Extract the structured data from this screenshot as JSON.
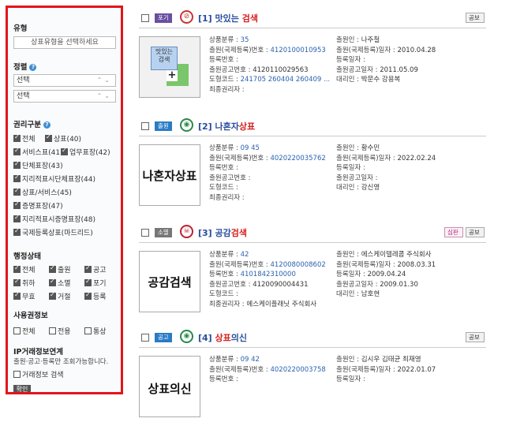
{
  "sidebar": {
    "type_section": {
      "title": "유형",
      "select_placeholder": "상표유형을 선택하세요"
    },
    "sort_section": {
      "title": "정렬",
      "select1": "선택",
      "select2": "선택"
    },
    "rights_section": {
      "title": "권리구분",
      "items": [
        {
          "label": "전체",
          "checked": true
        },
        {
          "label": "상표(40)",
          "checked": true
        },
        {
          "label": "서비스표(41)",
          "checked": true
        },
        {
          "label": "업무표장(42)",
          "checked": true
        },
        {
          "label": "단체표장(43)",
          "checked": true
        },
        {
          "label": "지리적표시단체표장(44)",
          "checked": true
        },
        {
          "label": "상표/서비스(45)",
          "checked": true
        },
        {
          "label": "증명표장(47)",
          "checked": true
        },
        {
          "label": "지리적표시증명표장(48)",
          "checked": true
        },
        {
          "label": "국제등록상표(마드리드)",
          "checked": true
        }
      ]
    },
    "status_section": {
      "title": "행정상태",
      "items": [
        {
          "label": "전체",
          "checked": true
        },
        {
          "label": "출원",
          "checked": true
        },
        {
          "label": "공고",
          "checked": true
        },
        {
          "label": "취하",
          "checked": true
        },
        {
          "label": "소멸",
          "checked": true
        },
        {
          "label": "포기",
          "checked": true
        },
        {
          "label": "무효",
          "checked": true
        },
        {
          "label": "거절",
          "checked": true
        },
        {
          "label": "등록",
          "checked": true
        }
      ]
    },
    "usage_section": {
      "title": "사용권정보",
      "items": [
        {
          "label": "전체",
          "checked": false
        },
        {
          "label": "전용",
          "checked": false
        },
        {
          "label": "통상",
          "checked": false
        }
      ]
    },
    "ip_section": {
      "title": "IP거래정보연계",
      "note": "출원·공고·등록만 조회가능합니다.",
      "checkbox_label": "거래정보 검색",
      "checked": false,
      "button_label": "확인"
    }
  },
  "results": [
    {
      "status": "포기",
      "status_color": "#6a4fa0",
      "icon": "circle-slash-icon",
      "icon_glyph": "⊘",
      "icon_color": "#c33",
      "num": "[1]",
      "title_plain": "맛있는 ",
      "title_hl": "검색",
      "tags": [
        "공보"
      ],
      "thumb_text_1": "맛있는",
      "thumb_text_2": "검색",
      "fields": {
        "prod_label": "상품분류 :",
        "prod_value": "35",
        "appno_label": "출원(국제등록)번호 :",
        "appno_value": "4120100010953",
        "regno_label": "등록번호 :",
        "regno_value": "",
        "pubno_label": "출원공고번호 :",
        "pubno_value": "4120110029563",
        "figure_label": "도형코드 :",
        "figure_value": "241705 260404 260409 ...",
        "owner_label": "최종권리자 :",
        "owner_value": "",
        "applicant_label": "출원인 :",
        "applicant_value": "나주철",
        "appdate_label": "출원(국제등록)일자 :",
        "appdate_value": "2010.04.28",
        "regdate_label": "등록일자 :",
        "regdate_value": "",
        "pubdate_label": "출원공고일자 :",
        "pubdate_value": "2011.05.09",
        "agent_label": "대리인 :",
        "agent_value": "박문수 강용복"
      }
    },
    {
      "status": "출원",
      "status_color": "#2a7bc5",
      "icon": "eye-icon",
      "icon_glyph": "◉",
      "icon_color": "#2a8a4a",
      "num": "[2]",
      "title_plain": "나혼자",
      "title_hl": "상표",
      "tags": [],
      "thumb_text": "나혼자상표",
      "fields": {
        "prod_label": "상품분류 :",
        "prod_value": "09 45",
        "appno_label": "출원(국제등록)번호 :",
        "appno_value": "4020220035762",
        "regno_label": "등록번호 :",
        "regno_value": "",
        "pubno_label": "출원공고번호 :",
        "pubno_value": "",
        "figure_label": "도형코드 :",
        "figure_value": "",
        "owner_label": "최종권리자 :",
        "owner_value": "",
        "applicant_label": "출원인 :",
        "applicant_value": "황수민",
        "appdate_label": "출원(국제등록)일자 :",
        "appdate_value": "2022.02.24",
        "regdate_label": "등록일자 :",
        "regdate_value": "",
        "pubdate_label": "출원공고일자 :",
        "pubdate_value": "",
        "agent_label": "대리인 :",
        "agent_value": "강신영"
      }
    },
    {
      "status": "소멸",
      "status_color": "#777777",
      "icon": "skull-icon",
      "icon_glyph": "☠",
      "icon_color": "#b23",
      "num": "[3]",
      "title_plain": "공감",
      "title_hl": "검색",
      "tags": [
        "심판",
        "공보"
      ],
      "thumb_text": "공감검색",
      "fields": {
        "prod_label": "상품분류 :",
        "prod_value": "42",
        "appno_label": "출원(국제등록)번호 :",
        "appno_value": "4120080008602",
        "regno_label": "등록번호 :",
        "regno_value": "4101842310000",
        "pubno_label": "출원공고번호 :",
        "pubno_value": "4120090004431",
        "figure_label": "도형코드 :",
        "figure_value": "",
        "owner_label": "최종권리자 :",
        "owner_value": "에스케이플래닛 주식회사",
        "applicant_label": "출원인 :",
        "applicant_value": "에스케이텔레콤 주식회사",
        "appdate_label": "출원(국제등록)일자 :",
        "appdate_value": "2008.03.31",
        "regdate_label": "등록일자 :",
        "regdate_value": "2009.04.24",
        "pubdate_label": "출원공고일자 :",
        "pubdate_value": "2009.01.30",
        "agent_label": "대리인 :",
        "agent_value": "남호현"
      }
    },
    {
      "status": "공고",
      "status_color": "#2a7bc5",
      "icon": "eye-icon",
      "icon_glyph": "◉",
      "icon_color": "#2a8a4a",
      "num": "[4]",
      "title_plain": "",
      "title_hl": "상표",
      "title_after": "의신",
      "tags": [
        "공보"
      ],
      "thumb_text": "상표의신",
      "fields": {
        "prod_label": "상품분류 :",
        "prod_value": "09 42",
        "appno_label": "출원(국제등록)번호 :",
        "appno_value": "4020220003758",
        "regno_label": "등록번호 :",
        "regno_value": "",
        "applicant_label": "출원인 :",
        "applicant_value": "김시우 김태균 최재영",
        "appdate_label": "출원(국제등록)일자 :",
        "appdate_value": "2022.01.07",
        "regdate_label": "등록일자 :",
        "regdate_value": ""
      }
    }
  ]
}
